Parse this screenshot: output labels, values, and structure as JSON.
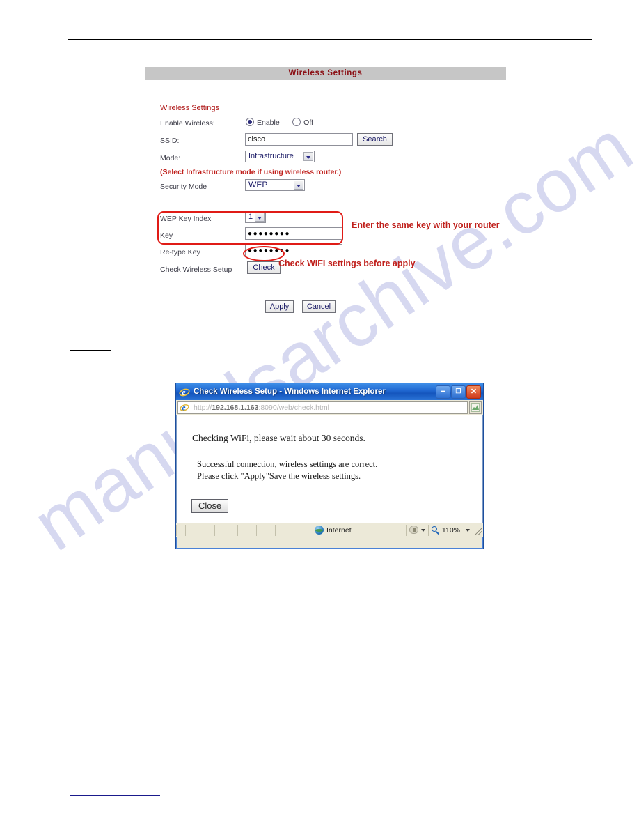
{
  "watermark": {
    "text": "manualsarchive.com"
  },
  "settings_panel": {
    "header_title": "Wireless Settings",
    "section_title": "Wireless Settings",
    "labels": {
      "enable_wireless": "Enable Wireless:",
      "ssid": "SSID:",
      "mode": "Mode:",
      "security_mode": "Security Mode",
      "wep_key_index": "WEP Key Index",
      "key": "Key",
      "retype_key": "Re-type Key",
      "check_wireless_setup": "Check Wireless Setup"
    },
    "radio_enable": "Enable",
    "radio_off": "Off",
    "ssid_value": "cisco",
    "ssid_placeholder": "",
    "search_button": "Search",
    "mode_value": "Infrastructure",
    "mode_note": "(Select Infrastructure mode if using wireless router.)",
    "security_mode_value": "WEP",
    "wep_key_index_value": "1",
    "key_value": "●●●●●●●●",
    "retype_key_value": "●●●●●●●●",
    "check_button": "Check",
    "apply_button": "Apply",
    "cancel_button": "Cancel",
    "annotations": {
      "key_note": "Enter the same key with your router",
      "check_note": "Check WIFI settings before apply"
    },
    "colors": {
      "header_bg": "#c6c6c6",
      "header_text": "#8b0f14",
      "annotation_red": "#e01b16",
      "note_red": "#c0201c"
    }
  },
  "ie_window": {
    "title": "Check Wireless Setup - Windows Internet Explorer",
    "minimize_glyph": "–",
    "maximize_glyph": "❐",
    "close_glyph": "✕",
    "url_scheme": "http://",
    "url_host": "192.168.1.163",
    "url_rest": ":8090/web/check.html",
    "url_full": "http://192.168.1.163:8090/web/check.html",
    "body": {
      "line1": "Checking WiFi, please wait about 30 seconds.",
      "line2": "Successful connection, wireless settings are correct.",
      "line3": "Please click \"Apply\"Save the wireless settings."
    },
    "close_button": "Close",
    "statusbar": {
      "zone": "Internet",
      "zoom": "110%"
    }
  }
}
